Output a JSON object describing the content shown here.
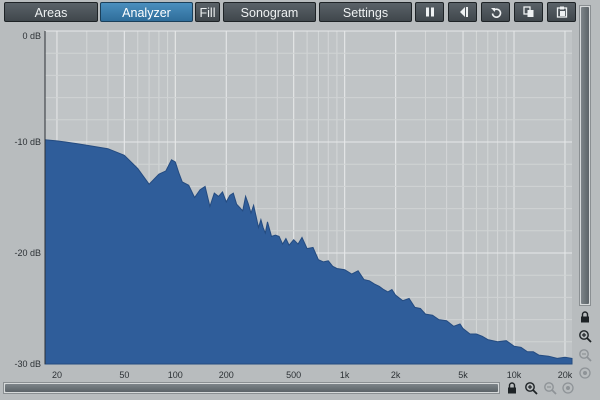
{
  "toolbar": {
    "areas": "Areas",
    "analyzer": "Analyzer",
    "fill": "Fill",
    "sonogram": "Sonogram",
    "settings": "Settings"
  },
  "icons": [
    "pause-icon",
    "reset-peaks-icon",
    "undo-icon",
    "copy-icon",
    "paste-icon",
    "lock-icon",
    "zoom-in-icon",
    "zoom-out-icon",
    "zoom-reset-icon"
  ],
  "chart_data": {
    "type": "area",
    "title": "",
    "xlabel": "",
    "ylabel": "",
    "x_scale": "log",
    "xlim": [
      17,
      22000
    ],
    "ylim": [
      -30,
      0
    ],
    "grid": true,
    "fill_color": "#2f5d9a",
    "x_ticks": [
      {
        "value": 20,
        "label": "20"
      },
      {
        "value": 50,
        "label": "50"
      },
      {
        "value": 100,
        "label": "100"
      },
      {
        "value": 200,
        "label": "200"
      },
      {
        "value": 500,
        "label": "500"
      },
      {
        "value": 1000,
        "label": "1k"
      },
      {
        "value": 2000,
        "label": "2k"
      },
      {
        "value": 5000,
        "label": "5k"
      },
      {
        "value": 10000,
        "label": "10k"
      },
      {
        "value": 20000,
        "label": "20k"
      }
    ],
    "y_ticks": [
      {
        "value": 0,
        "label": "0 dB"
      },
      {
        "value": -10,
        "label": "-10 dB"
      },
      {
        "value": -20,
        "label": "-20 dB"
      },
      {
        "value": -30,
        "label": "-30 dB"
      }
    ],
    "series": [
      {
        "x": [
          17,
          20,
          25,
          30,
          40,
          50,
          60,
          70,
          80,
          88,
          95,
          100,
          105,
          110,
          120,
          130,
          140,
          150,
          160,
          170,
          180,
          190,
          200,
          210,
          220,
          230,
          240,
          250,
          260,
          270,
          280,
          290,
          300,
          310,
          320,
          330,
          340,
          350,
          370,
          390,
          410,
          430,
          450,
          470,
          500,
          530,
          560,
          600,
          650,
          700,
          750,
          800,
          850,
          900,
          1000,
          1100,
          1200,
          1300,
          1400,
          1500,
          1600,
          1700,
          1800,
          1900,
          2000,
          2200,
          2400,
          2600,
          2800,
          3000,
          3300,
          3600,
          4000,
          4400,
          4800,
          5000,
          5500,
          6000,
          6500,
          7000,
          8000,
          9000,
          10000,
          11000,
          12000,
          13000,
          14000,
          16000,
          18000,
          20000,
          22000
        ],
        "y": [
          -9.8,
          -9.9,
          -10.1,
          -10.3,
          -10.6,
          -11.2,
          -12.4,
          -13.8,
          -12.9,
          -12.6,
          -11.6,
          -11.8,
          -12.8,
          -13.6,
          -13.9,
          -15.0,
          -14.3,
          -14.0,
          -15.8,
          -14.6,
          -14.9,
          -14.5,
          -15.4,
          -14.8,
          -14.6,
          -15.6,
          -15.9,
          -16.2,
          -14.9,
          -15.6,
          -16.4,
          -15.7,
          -16.7,
          -17.7,
          -17.0,
          -17.7,
          -18.2,
          -17.2,
          -18.5,
          -18.4,
          -18.5,
          -19.2,
          -18.7,
          -19.3,
          -18.8,
          -19.2,
          -18.6,
          -19.6,
          -19.5,
          -20.6,
          -20.8,
          -20.7,
          -21.2,
          -21.4,
          -21.5,
          -21.9,
          -21.6,
          -22.4,
          -22.5,
          -22.8,
          -23.0,
          -23.3,
          -23.5,
          -23.3,
          -23.8,
          -24.3,
          -24.1,
          -24.9,
          -25.0,
          -25.5,
          -25.6,
          -26.0,
          -26.1,
          -26.6,
          -26.4,
          -26.8,
          -27.3,
          -27.3,
          -27.5,
          -27.8,
          -28.0,
          -27.9,
          -28.4,
          -28.5,
          -28.9,
          -28.9,
          -29.2,
          -29.3,
          -29.5,
          -29.4,
          -29.5
        ]
      }
    ]
  }
}
